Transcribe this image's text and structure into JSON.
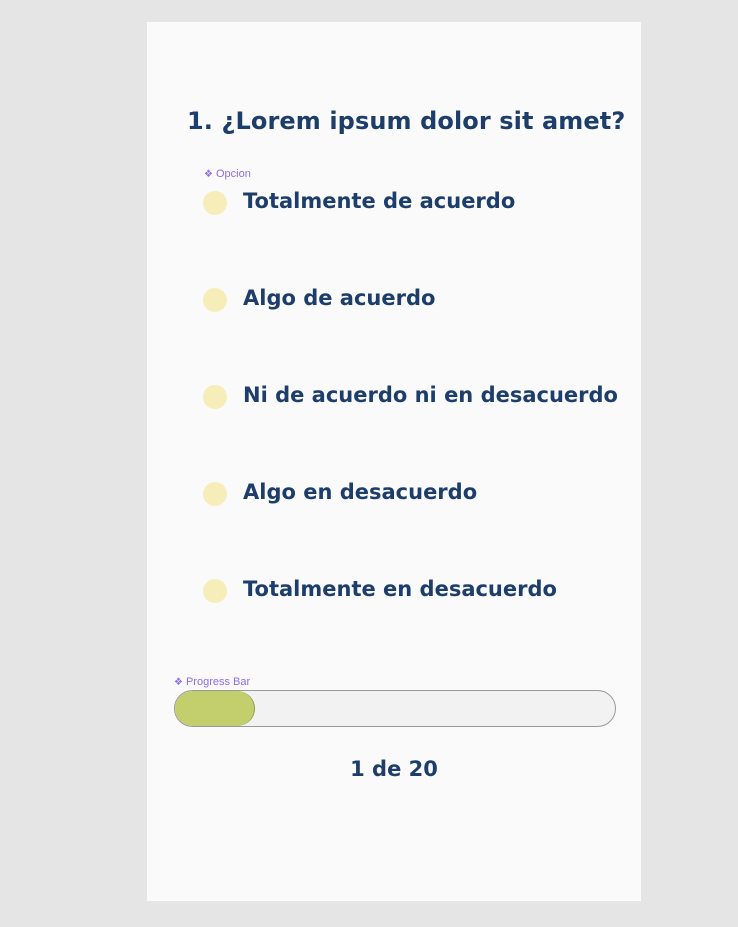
{
  "question": {
    "title": "1. ¿Lorem ipsum dolor sit amet?"
  },
  "components": {
    "option_tag": "Opcion",
    "progress_tag": "Progress Bar",
    "tag_icon": "component-icon"
  },
  "options": [
    {
      "label": "Totalmente de acuerdo",
      "icon": "radio-circle-icon"
    },
    {
      "label": "Algo de acuerdo",
      "icon": "radio-circle-icon"
    },
    {
      "label": "Ni de acuerdo ni en desacuerdo",
      "icon": "radio-circle-icon"
    },
    {
      "label": "Algo en desacuerdo",
      "icon": "radio-circle-icon"
    },
    {
      "label": "Totalmente en desacuerdo",
      "icon": "radio-circle-icon"
    }
  ],
  "progress": {
    "current": "1",
    "total": "20",
    "text": "1 de 20",
    "fill_fraction": 0.18
  },
  "colors": {
    "page_background": "#e5e5e5",
    "card_background": "#fafafa",
    "text_primary": "#1d3d6b",
    "radio_fill": "#f6edb8",
    "progress_fill": "#c3cf6c",
    "progress_track": "#f2f2f2",
    "component_tag": "#8a6cf0"
  }
}
